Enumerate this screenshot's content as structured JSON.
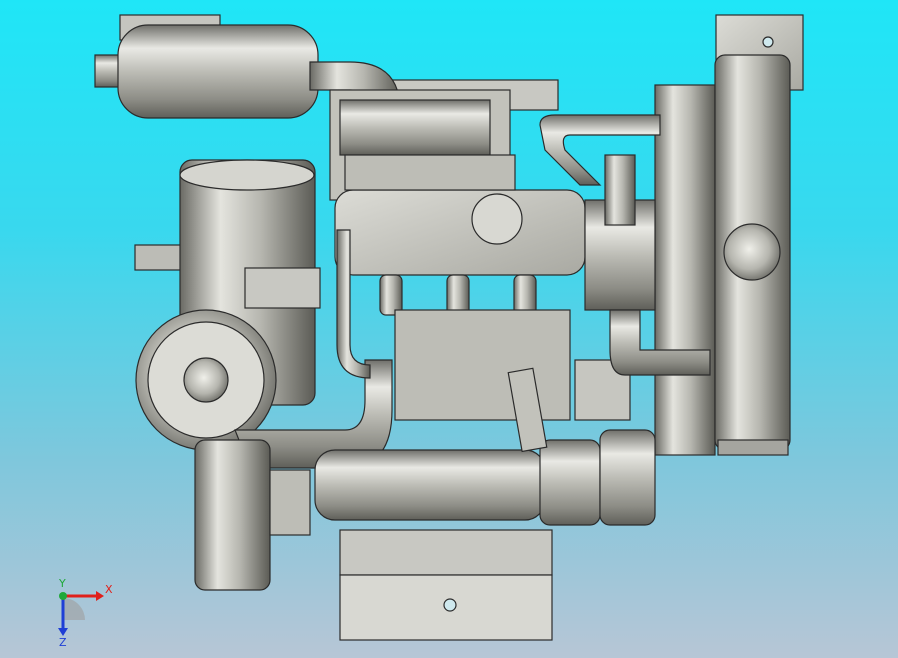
{
  "viewport": {
    "background_top": "#1fe6f7",
    "background_bottom": "#b7c6d6",
    "model_description_icon": "engine-assembly-3d-model"
  },
  "triad": {
    "x_label": "X",
    "y_label": "Y",
    "z_label": "Z",
    "x_color": "#e0201b",
    "y_color": "#1fa83a",
    "z_color": "#1f3fd6"
  }
}
